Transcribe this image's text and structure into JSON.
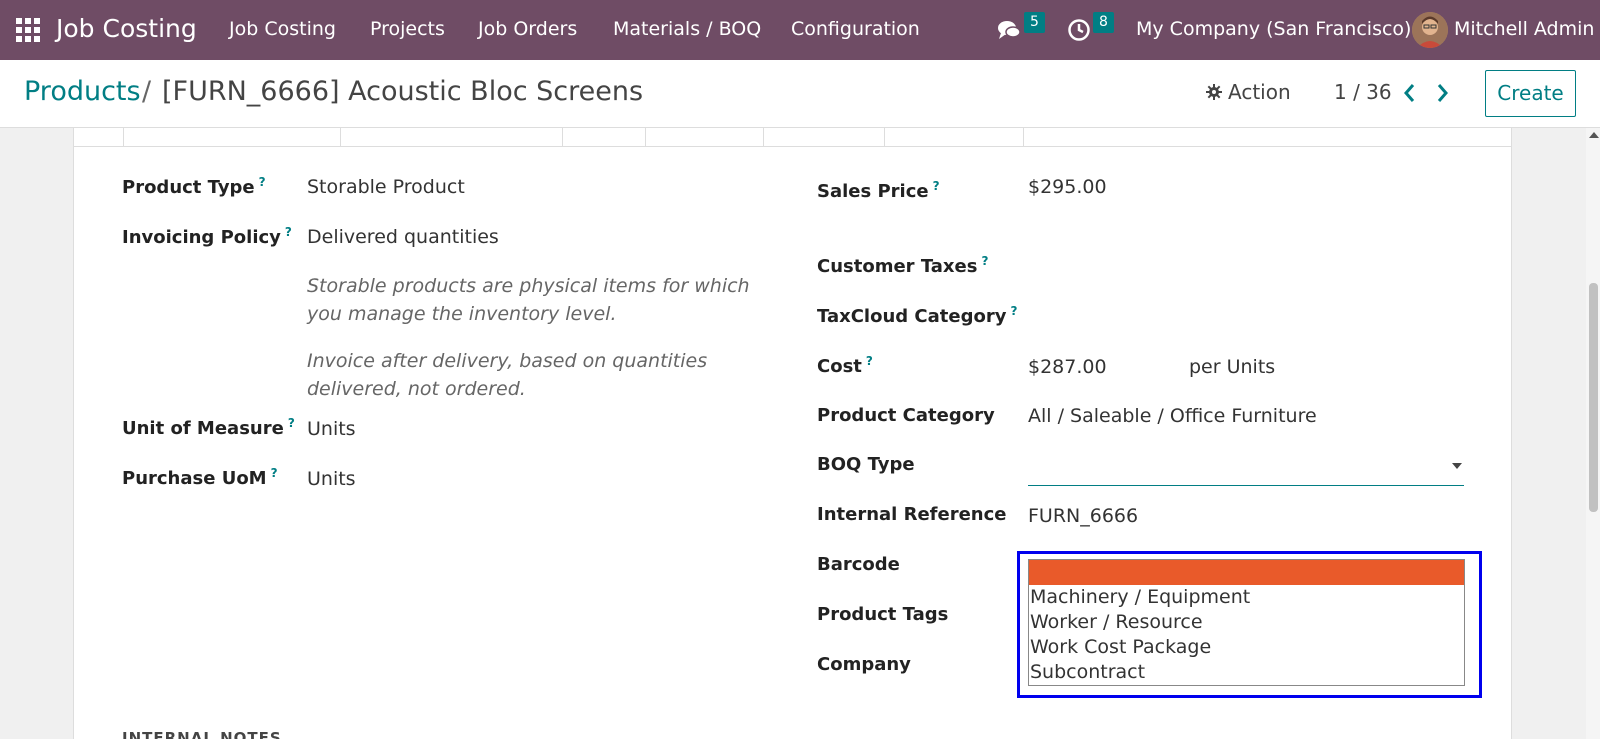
{
  "topnav": {
    "brand": "Job Costing",
    "menus": [
      "Job Costing",
      "Projects",
      "Job Orders",
      "Materials / BOQ",
      "Configuration"
    ],
    "chat_count": "5",
    "activity_count": "8",
    "company": "My Company (San Francisco)",
    "user": "Mitchell Admin"
  },
  "control_panel": {
    "breadcrumb_parent": "Products",
    "breadcrumb_sep": "/",
    "breadcrumb_current": "[FURN_6666] Acoustic Bloc Screens",
    "action_label": "Action",
    "pager": "1 / 36",
    "create_label": "Create"
  },
  "form": {
    "left": {
      "product_type_label": "Product Type",
      "product_type_value": "Storable Product",
      "invoicing_policy_label": "Invoicing Policy",
      "invoicing_policy_value": "Delivered quantities",
      "help_storable": "Storable products are physical items for which you manage the inventory level.",
      "help_invoice": "Invoice after delivery, based on quantities delivered, not ordered.",
      "uom_label": "Unit of Measure",
      "uom_value": "Units",
      "purchase_uom_label": "Purchase UoM",
      "purchase_uom_value": "Units",
      "help_marker": "?"
    },
    "right": {
      "sales_price_label": "Sales Price",
      "sales_price_value": "$295.00",
      "customer_taxes_label": "Customer Taxes",
      "taxcloud_label": "TaxCloud Category",
      "cost_label": "Cost",
      "cost_value": "$287.00",
      "cost_unit": "per Units",
      "product_category_label": "Product Category",
      "product_category_value": "All / Saleable / Office Furniture",
      "boq_type_label": "BOQ Type",
      "internal_ref_label": "Internal Reference",
      "internal_ref_value": "FURN_6666",
      "barcode_label": "Barcode",
      "product_tags_label": "Product Tags",
      "company_label": "Company"
    },
    "boq_options": [
      "Machinery / Equipment",
      "Worker / Resource",
      "Work Cost Package",
      "Subcontract"
    ],
    "notes_label": "INTERNAL NOTES"
  },
  "colors": {
    "nav": "#6f4c65",
    "accent": "#017e84",
    "selected_option": "#e95a2a",
    "highlight_box": "#0000ee"
  }
}
